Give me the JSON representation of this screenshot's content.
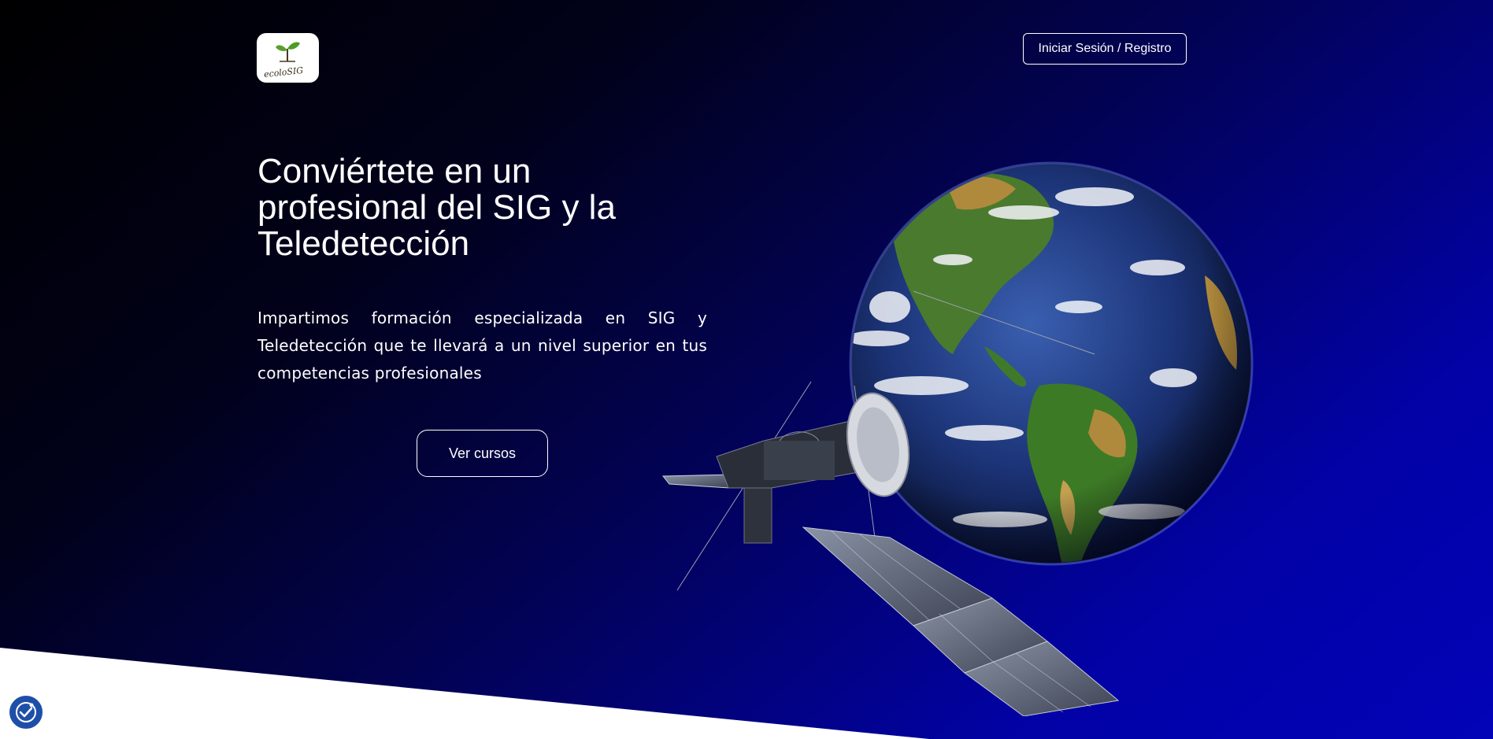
{
  "brand": {
    "logo_text": "ecoloSIG"
  },
  "header": {
    "login_label": "Iniciar Sesión / Registro"
  },
  "hero": {
    "title": "Conviértete en un profesional del SIG y la Teledetección",
    "lead": "Impartimos formación especializada en SIG y Teledetección que te llevará a un nivel superior en tus competencias profesionales",
    "cta_label": "Ver cursos"
  },
  "icons": {
    "logo": "sprout-logo-icon",
    "earth": "earth-globe-image",
    "satellite": "satellite-image",
    "accessibility": "accessibility-check-icon"
  },
  "colors": {
    "gradient_start": "#000000",
    "gradient_end": "#0303b8",
    "accessibility_button": "#1e4fa8"
  }
}
